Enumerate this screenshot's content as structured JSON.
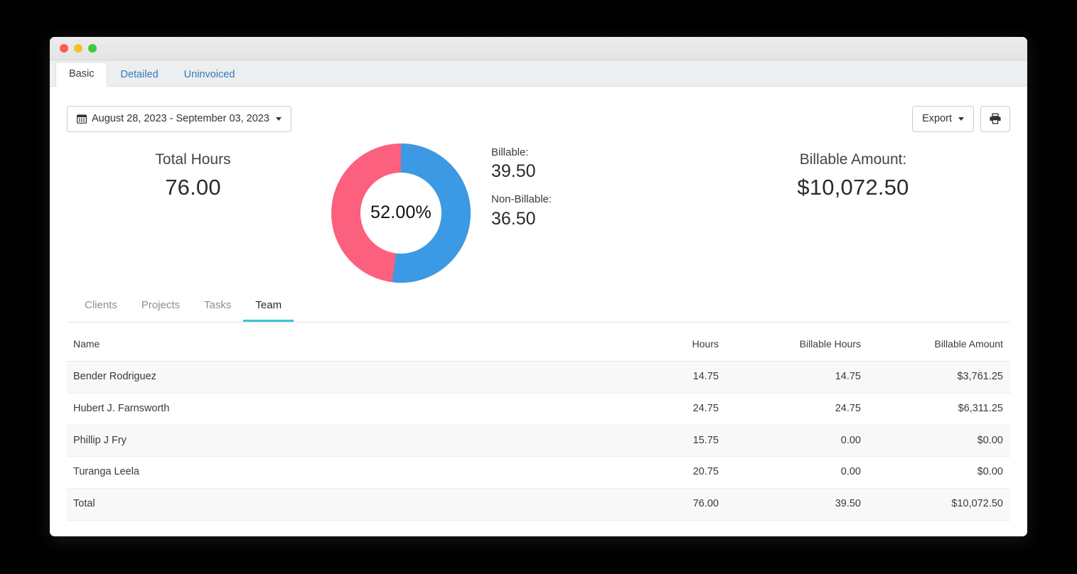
{
  "window": {
    "traffic_lights": [
      "close",
      "minimize",
      "zoom"
    ]
  },
  "top_tabs": [
    {
      "label": "Basic",
      "active": true
    },
    {
      "label": "Detailed",
      "active": false
    },
    {
      "label": "Uninvoiced",
      "active": false
    }
  ],
  "toolbar": {
    "date_range": "August 28, 2023 - September 03, 2023",
    "calendar_icon": "calendar-icon",
    "export_label": "Export",
    "print_icon": "printer-icon"
  },
  "summary": {
    "total_hours_label": "Total Hours",
    "total_hours_value": "76.00",
    "billable_label": "Billable:",
    "billable_value": "39.50",
    "non_billable_label": "Non-Billable:",
    "non_billable_value": "36.50",
    "billable_amount_label": "Billable Amount:",
    "billable_amount_value": "$10,072.50",
    "donut_center_text": "52.00%"
  },
  "chart_data": {
    "type": "pie",
    "title": "",
    "categories": [
      "Billable",
      "Non-Billable"
    ],
    "values": [
      39.5,
      36.5
    ],
    "percentages": [
      52.0,
      48.0
    ],
    "colors": [
      "#3b9ae3",
      "#fc607f"
    ],
    "center_label": "52.00%",
    "donut": true,
    "inner_radius_ratio": 0.58,
    "start_angle_deg": 0,
    "direction": "clockwise",
    "legend": "none"
  },
  "sub_tabs": [
    {
      "label": "Clients",
      "active": false
    },
    {
      "label": "Projects",
      "active": false
    },
    {
      "label": "Tasks",
      "active": false
    },
    {
      "label": "Team",
      "active": true
    }
  ],
  "table": {
    "columns": [
      "Name",
      "Hours",
      "Billable Hours",
      "Billable Amount"
    ],
    "rows": [
      {
        "name": "Bender Rodriguez",
        "hours": "14.75",
        "billable_hours": "14.75",
        "billable_amount": "$3,761.25"
      },
      {
        "name": "Hubert J. Farnsworth",
        "hours": "24.75",
        "billable_hours": "24.75",
        "billable_amount": "$6,311.25"
      },
      {
        "name": "Phillip J Fry",
        "hours": "15.75",
        "billable_hours": "0.00",
        "billable_amount": "$0.00"
      },
      {
        "name": "Turanga Leela",
        "hours": "20.75",
        "billable_hours": "0.00",
        "billable_amount": "$0.00"
      },
      {
        "name": "Total",
        "hours": "76.00",
        "billable_hours": "39.50",
        "billable_amount": "$10,072.50"
      }
    ]
  },
  "colors": {
    "billable": "#3b9ae3",
    "non_billable": "#fc607f",
    "active_subtab_underline": "#38c6d2",
    "link": "#337ab7"
  }
}
